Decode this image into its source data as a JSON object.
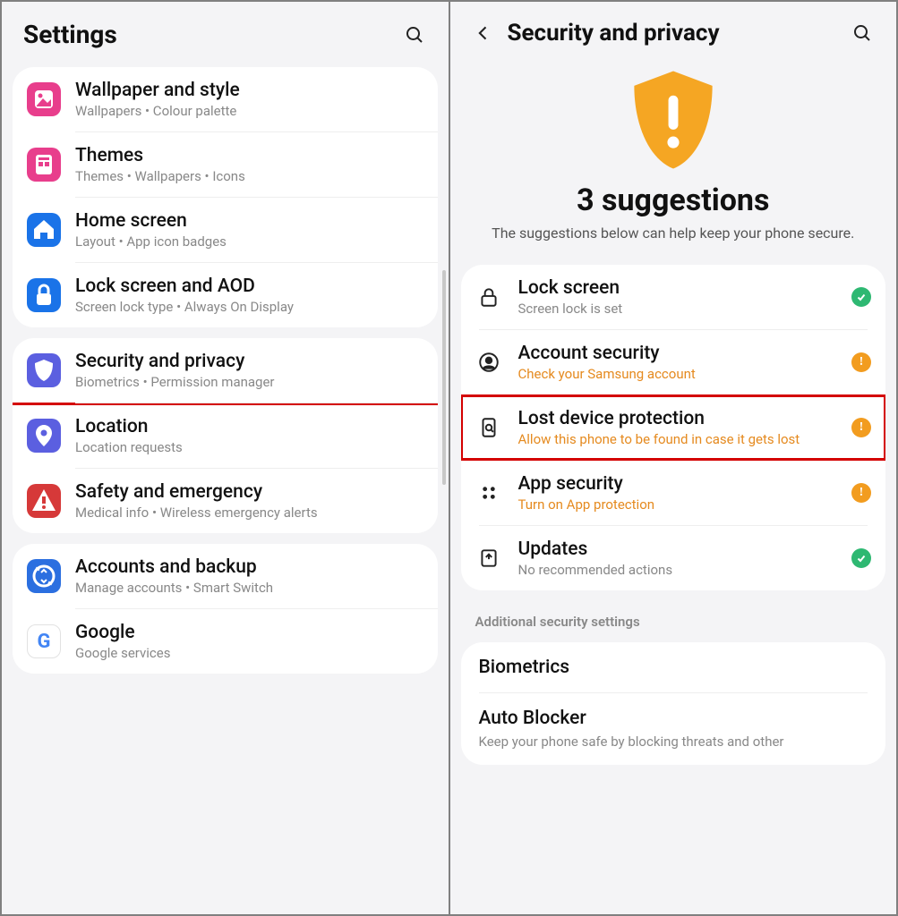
{
  "left": {
    "title": "Settings",
    "groups": [
      [
        {
          "title": "Wallpaper and style",
          "sub": "Wallpapers  •  Colour palette",
          "icon": "wallpaper",
          "color": "#e83e8c"
        },
        {
          "title": "Themes",
          "sub": "Themes  •  Wallpapers  •  Icons",
          "icon": "themes",
          "color": "#e83e8c"
        },
        {
          "title": "Home screen",
          "sub": "Layout  •  App icon badges",
          "icon": "home",
          "color": "#1a73e8"
        },
        {
          "title": "Lock screen and AOD",
          "sub": "Screen lock type  •  Always On Display",
          "icon": "lock",
          "color": "#1a73e8"
        }
      ],
      [
        {
          "title": "Security and privacy",
          "sub": "Biometrics  •  Permission manager",
          "icon": "shield",
          "color": "#5b5fe0",
          "highlight": true
        },
        {
          "title": "Location",
          "sub": "Location requests",
          "icon": "location",
          "color": "#5b5fe0"
        },
        {
          "title": "Safety and emergency",
          "sub": "Medical info  •  Wireless emergency alerts",
          "icon": "emergency",
          "color": "#d63939"
        }
      ],
      [
        {
          "title": "Accounts and backup",
          "sub": "Manage accounts  •  Smart Switch",
          "icon": "backup",
          "color": "#2b6fe0"
        },
        {
          "title": "Google",
          "sub": "Google services",
          "icon": "google",
          "color": "#ffffff"
        }
      ]
    ]
  },
  "right": {
    "title": "Security and privacy",
    "suggestions_title": "3 suggestions",
    "suggestions_text": "The suggestions below can help keep your phone secure.",
    "items": [
      {
        "title": "Lock screen",
        "sub": "Screen lock is set",
        "sub_style": "gray",
        "icon": "padlock",
        "status": "ok"
      },
      {
        "title": "Account security",
        "sub": "Check your Samsung account",
        "sub_style": "orange",
        "icon": "account",
        "status": "warn"
      },
      {
        "title": "Lost device protection",
        "sub": "Allow this phone to be found in case it gets lost",
        "sub_style": "orange",
        "icon": "finddevice",
        "status": "warn",
        "highlight": true
      },
      {
        "title": "App security",
        "sub": "Turn on App protection",
        "sub_style": "orange",
        "icon": "apps",
        "status": "warn"
      },
      {
        "title": "Updates",
        "sub": "No recommended actions",
        "sub_style": "gray",
        "icon": "updates",
        "status": "ok"
      }
    ],
    "section_header": "Additional security settings",
    "extra": [
      {
        "title": "Biometrics",
        "sub": ""
      },
      {
        "title": "Auto Blocker",
        "sub": "Keep your phone safe by blocking threats and other"
      }
    ]
  }
}
